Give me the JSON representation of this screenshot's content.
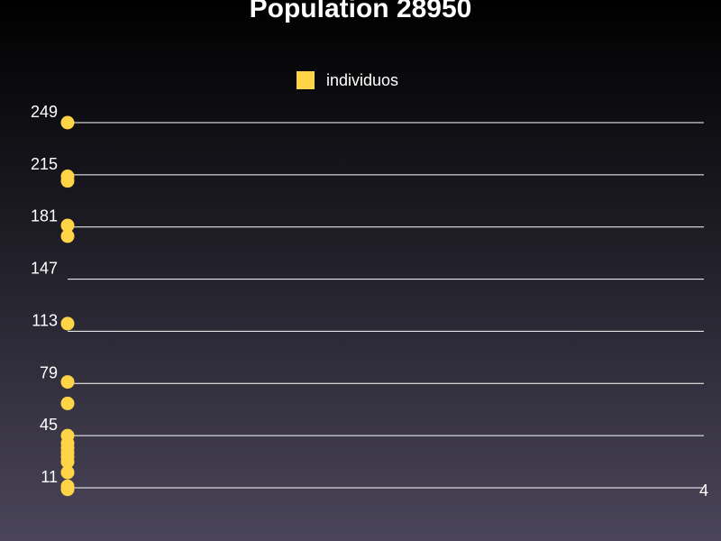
{
  "chart_data": {
    "type": "scatter",
    "title": "Population 28950",
    "xlabel": "",
    "ylabel": "",
    "grid": true,
    "legend_placement": "top-center",
    "series": [
      {
        "name": "individuos",
        "color": "#ffd447",
        "points": [
          {
            "x": 0,
            "y": 249
          },
          {
            "x": 0,
            "y": 214
          },
          {
            "x": 0,
            "y": 211
          },
          {
            "x": 0,
            "y": 182
          },
          {
            "x": 0,
            "y": 175
          },
          {
            "x": 0,
            "y": 118
          },
          {
            "x": 0,
            "y": 80
          },
          {
            "x": 0,
            "y": 66
          },
          {
            "x": 0,
            "y": 45
          },
          {
            "x": 0,
            "y": 40
          },
          {
            "x": 0,
            "y": 37
          },
          {
            "x": 0,
            "y": 34
          },
          {
            "x": 0,
            "y": 31
          },
          {
            "x": 0,
            "y": 28
          },
          {
            "x": 0,
            "y": 21
          },
          {
            "x": 0,
            "y": 12
          },
          {
            "x": 0,
            "y": 10
          }
        ]
      }
    ],
    "y_ticks": [
      "249",
      "215",
      "181",
      "147",
      "113",
      "79",
      "45",
      "11"
    ],
    "y_tick_values": [
      249,
      215,
      181,
      147,
      113,
      79,
      45,
      11
    ],
    "x_ticks": [
      "4"
    ],
    "x_tick_values": [
      4
    ],
    "xlim": [
      0,
      4
    ],
    "ylim": [
      11,
      249
    ]
  }
}
